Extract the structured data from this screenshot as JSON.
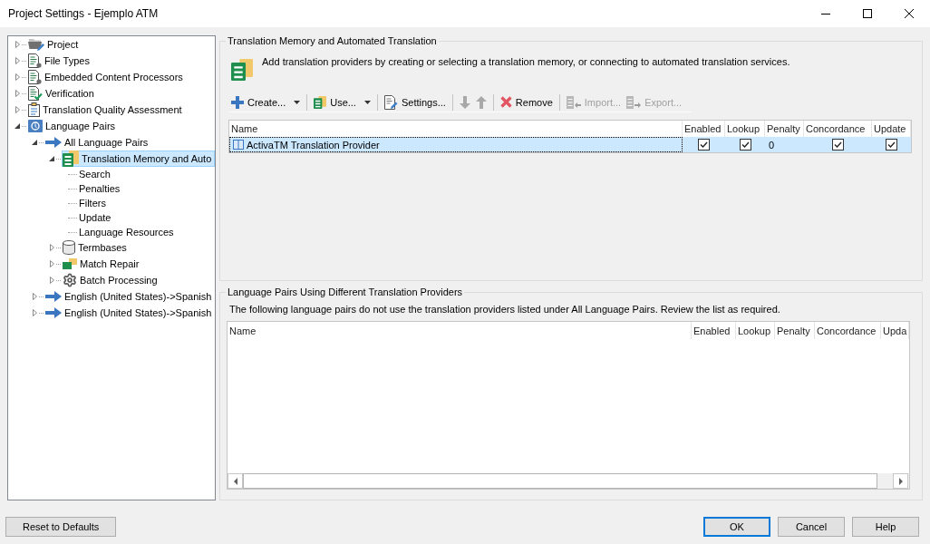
{
  "window": {
    "title": "Project Settings - Ejemplo ATM"
  },
  "tree": [
    {
      "label": "Project",
      "kind": "project",
      "expanded": false,
      "selected": false
    },
    {
      "label": "File Types",
      "kind": "filetypes",
      "expanded": false,
      "selected": false
    },
    {
      "label": "Embedded Content Processors",
      "kind": "processors",
      "expanded": false,
      "selected": false
    },
    {
      "label": "Verification",
      "kind": "verification",
      "expanded": false,
      "selected": false
    },
    {
      "label": "Translation Quality Assessment",
      "kind": "quality",
      "expanded": false,
      "selected": false
    },
    {
      "label": "Language Pairs",
      "kind": "languages",
      "expanded": true,
      "selected": false,
      "children": [
        {
          "label": "All Language Pairs",
          "kind": "pair",
          "expanded": true,
          "selected": false,
          "children": [
            {
              "label": "Translation Memory and Auto",
              "kind": "memory",
              "expanded": true,
              "selected": true,
              "children": [
                {
                  "label": "Search",
                  "selected": false
                },
                {
                  "label": "Penalties",
                  "selected": false
                },
                {
                  "label": "Filters",
                  "selected": false
                },
                {
                  "label": "Update",
                  "selected": false
                },
                {
                  "label": "Language Resources",
                  "selected": false
                }
              ]
            },
            {
              "label": "Termbases",
              "kind": "termbase",
              "expanded": false,
              "selected": false
            },
            {
              "label": "Match Repair",
              "kind": "repair",
              "expanded": false,
              "selected": false
            },
            {
              "label": "Batch Processing",
              "kind": "batch",
              "expanded": false,
              "selected": false
            }
          ]
        },
        {
          "label": "English (United States)->Spanish",
          "kind": "pair",
          "expanded": false,
          "selected": false
        },
        {
          "label": "English (United States)->Spanish",
          "kind": "pair",
          "expanded": false,
          "selected": false
        }
      ]
    }
  ],
  "providers": {
    "title": "Translation Memory and Automated Translation",
    "description": "Add translation providers by creating or selecting a translation memory, or connecting to automated translation services.",
    "toolbar": [
      [
        {
          "kind": "create",
          "label": "Create...",
          "dropdown": true,
          "disabled": false
        }
      ],
      [
        {
          "kind": "use",
          "label": "Use...",
          "dropdown": true,
          "disabled": false
        }
      ],
      [
        {
          "kind": "settings",
          "label": "Settings...",
          "dropdown": false,
          "disabled": false
        }
      ],
      [
        {
          "kind": "down",
          "dropdown": false,
          "disabled": true
        },
        {
          "kind": "up",
          "dropdown": false,
          "disabled": true
        }
      ],
      [
        {
          "kind": "remove",
          "label": "Remove",
          "dropdown": false,
          "disabled": false
        }
      ],
      [
        {
          "kind": "import",
          "label": "Import...",
          "dropdown": false,
          "disabled": true
        },
        {
          "kind": "export",
          "label": "Export...",
          "dropdown": false,
          "disabled": true
        }
      ]
    ],
    "table": {
      "columns": [
        "Name",
        "Enabled",
        "Lookup",
        "Penalty",
        "Concordance",
        "Update"
      ],
      "rows": [
        {
          "selected": true,
          "focused": true,
          "cells": [
            {
              "kind": "provider",
              "text": "ActivaTM Translation Provider"
            },
            {
              "kind": "check",
              "checked": true
            },
            {
              "kind": "check",
              "checked": true
            },
            {
              "kind": "text",
              "text": "0"
            },
            {
              "kind": "check",
              "checked": true
            },
            {
              "kind": "check",
              "checked": true
            }
          ]
        }
      ]
    }
  },
  "other_pairs": {
    "title": "Language Pairs Using Different Translation Providers",
    "description": "The following language pairs do not use the translation providers listed under All Language Pairs. Review the list as required.",
    "table": {
      "columns": [
        "Name",
        "Enabled",
        "Lookup",
        "Penalty",
        "Concordance",
        "Upda"
      ]
    }
  },
  "buttons": [
    {
      "label": "Reset to Defaults",
      "default": false
    },
    {
      "label": "OK",
      "default": true
    },
    {
      "label": "Cancel",
      "default": false
    },
    {
      "label": "Help",
      "default": false
    }
  ]
}
